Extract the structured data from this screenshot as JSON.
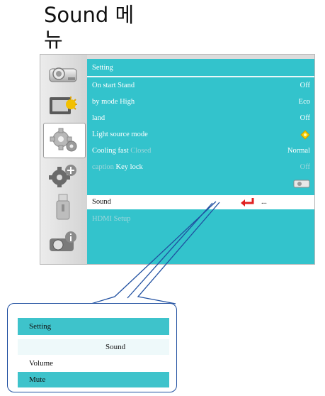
{
  "heading": "Sound 메뉴",
  "menu": {
    "title": "Setting",
    "rows": [
      {
        "label": "On start  Stand",
        "value": "Off"
      },
      {
        "label": "by mode  High",
        "value": "Eco"
      },
      {
        "label": "land",
        "value": "Off"
      },
      {
        "label": "Light source mode",
        "value": ""
      },
      {
        "label": "Cooling fast",
        "label_dim": "Closed",
        "value": "Normal"
      },
      {
        "label_dim_prefix": "caption",
        "label": "Key lock",
        "value": "Off"
      }
    ],
    "selected": {
      "label": "Sound",
      "ellipsis": "..."
    },
    "after": {
      "label": "HDMI Setup"
    }
  },
  "icons": [
    "projector-icon",
    "picture-icon",
    "setting-gear-icon",
    "extended-gear-icon",
    "usb-icon",
    "info-icon"
  ],
  "callout": {
    "title": "Setting",
    "header": "Sound",
    "items": [
      "Volume",
      "Mute"
    ]
  },
  "colors": {
    "accent": "#33c3cc",
    "callout_border": "#1f4fa0",
    "return_arrow": "#e02020"
  }
}
